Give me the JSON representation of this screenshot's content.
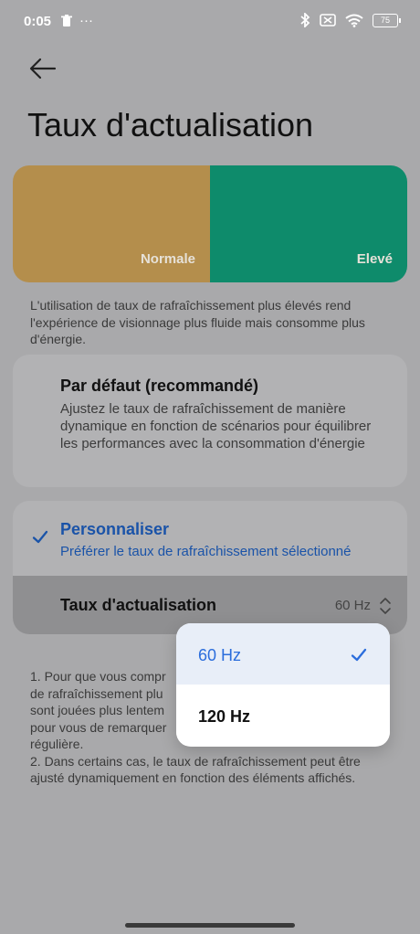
{
  "status_bar": {
    "time": "0:05",
    "more": "···",
    "battery": "75"
  },
  "page": {
    "title": "Taux d'actualisation"
  },
  "preview": {
    "normal_label": "Normale",
    "high_label": "Elevé",
    "normal_color": "#b48e4c",
    "high_color": "#0e8b6b"
  },
  "description": "L'utilisation de taux de rafraîchissement plus élevés rend l'expérience de visionnage plus fluide mais consomme plus d'énergie.",
  "options": {
    "default": {
      "title": "Par défaut (recommandé)",
      "subtitle": "Ajustez le taux de rafraîchissement de manière dynamique en fonction de scénarios pour équilibrer les performances avec la consommation d'énergie"
    },
    "custom": {
      "title": "Personnaliser",
      "subtitle": "Préférer le taux de rafraîchissement sélectionné",
      "selected": true
    }
  },
  "rate_setting": {
    "label": "Taux d'actualisation",
    "value": "60 Hz"
  },
  "notes": {
    "line1": "1. Pour que vous compr",
    "line2": "de rafraîchissement plu",
    "line3": "sont jouées plus lentem",
    "line4": "pour vous de remarquer",
    "line5": "régulière.",
    "line6": "2. Dans certains cas, le taux de rafraîchissement peut être ajusté dynamiquement en fonction des éléments affichés."
  },
  "dropdown": {
    "options": [
      {
        "label": "60 Hz",
        "selected": true
      },
      {
        "label": "120 Hz",
        "selected": false
      }
    ]
  },
  "colors": {
    "accent": "#2b6ddc",
    "dim_background": "#a9a9ab"
  }
}
